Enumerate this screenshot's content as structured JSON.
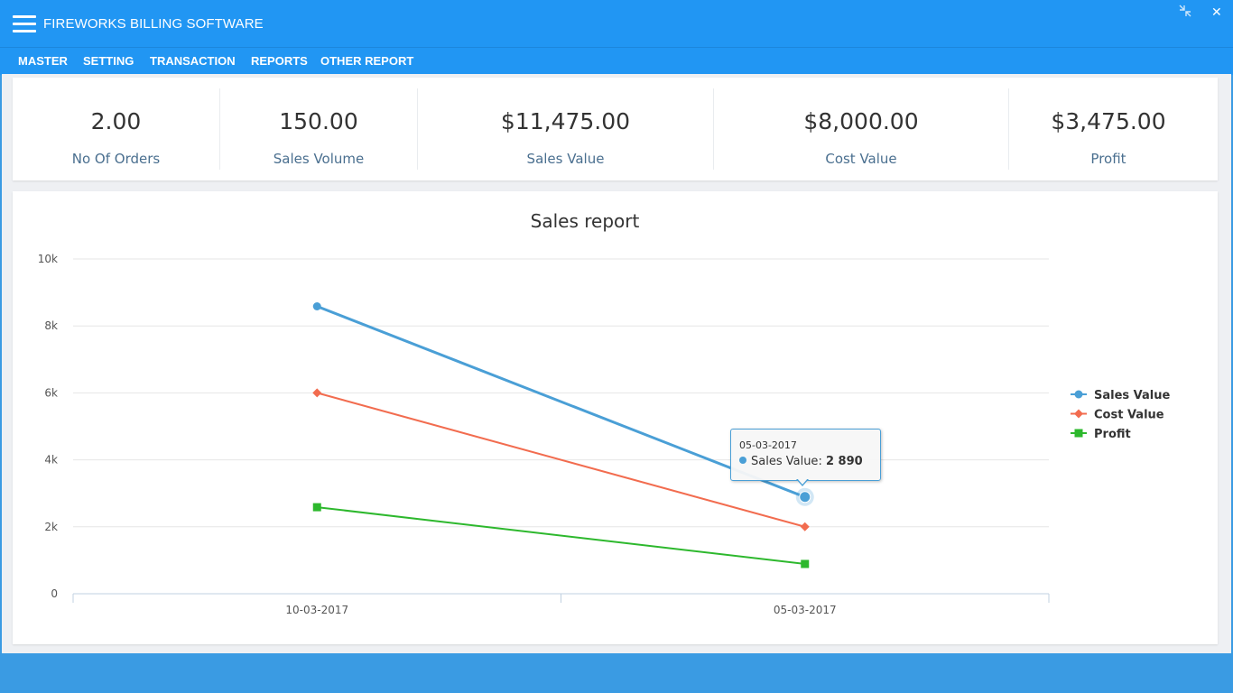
{
  "app": {
    "title": "FIREWORKS BILLING SOFTWARE",
    "minimize_icon": "compress-icon",
    "close_label": "✕"
  },
  "menu": [
    "MASTER",
    "SETTING",
    "TRANSACTION",
    "REPORTS",
    "OTHER REPORT"
  ],
  "stats": [
    {
      "value": "2.00",
      "label": "No Of Orders"
    },
    {
      "value": "150.00",
      "label": "Sales Volume"
    },
    {
      "value": "$11,475.00",
      "label": "Sales Value"
    },
    {
      "value": "$8,000.00",
      "label": "Cost Value"
    },
    {
      "value": "$3,475.00",
      "label": "Profit"
    }
  ],
  "tooltip": {
    "date": "05-03-2017",
    "series": "Sales Value",
    "value": "2 890"
  },
  "chart_data": {
    "type": "line",
    "title": "Sales report",
    "categories": [
      "10-03-2017",
      "05-03-2017"
    ],
    "ylim": [
      0,
      10000
    ],
    "yticks": [
      "0",
      "2k",
      "4k",
      "6k",
      "8k",
      "10k"
    ],
    "ytick_values": [
      0,
      2000,
      4000,
      6000,
      8000,
      10000
    ],
    "grid": true,
    "legend": "right",
    "series": [
      {
        "name": "Sales Value",
        "values": [
          8585,
          2890
        ],
        "color": "#4a9fd6",
        "marker": "circle"
      },
      {
        "name": "Cost Value",
        "values": [
          6000,
          2000
        ],
        "color": "#f26c4f",
        "marker": "diamond"
      },
      {
        "name": "Profit",
        "values": [
          2585,
          890
        ],
        "color": "#2db82d",
        "marker": "square"
      }
    ]
  }
}
